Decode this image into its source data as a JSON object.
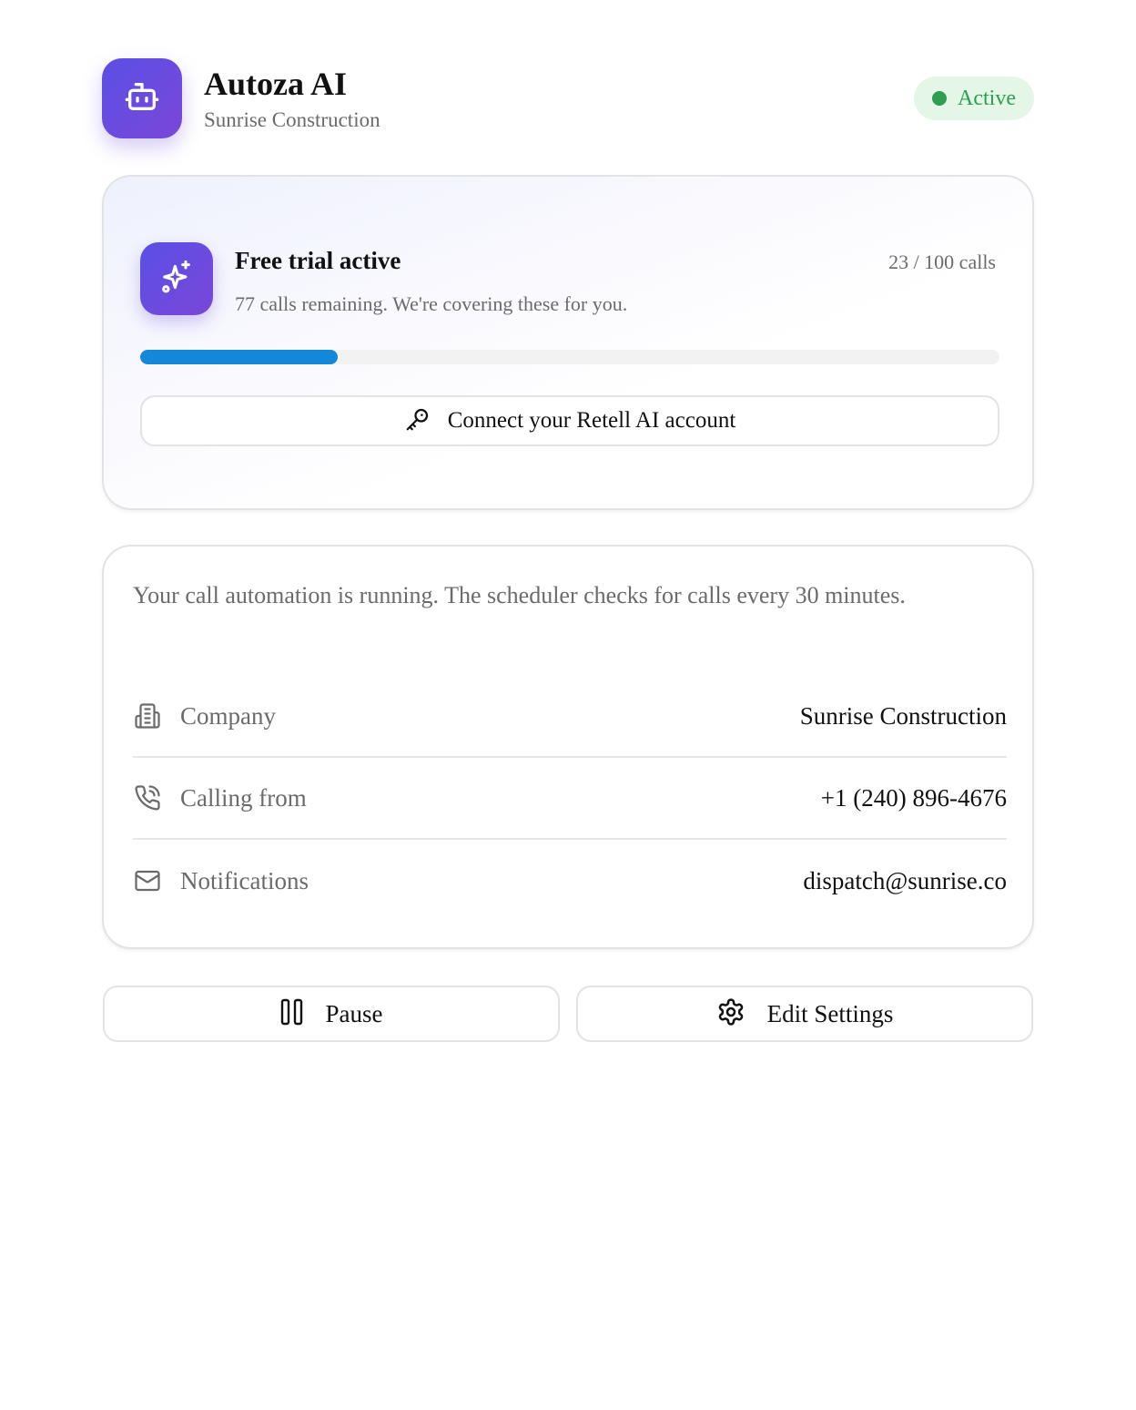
{
  "header": {
    "title": "Autoza AI",
    "subtitle": "Sunrise Construction",
    "logo_icon": "robot-icon",
    "status": {
      "label": "Active",
      "color": "#2e9e52"
    }
  },
  "trial": {
    "icon": "sparkles-icon",
    "title": "Free trial active",
    "count_label": "23 / 100 calls",
    "description": "77 calls remaining. We're covering these for you.",
    "progress_percent": 23,
    "progress_color": "#1487d9",
    "connect_button": {
      "icon": "key-icon",
      "label": "Connect your Retell AI account"
    }
  },
  "info": {
    "message": "Your call automation is running. The scheduler checks for calls every 30 minutes.",
    "rows": [
      {
        "icon": "building-icon",
        "label": "Company",
        "value": "Sunrise Construction"
      },
      {
        "icon": "phone-icon",
        "label": "Calling from",
        "value": "+1 (240) 896-4676"
      },
      {
        "icon": "mail-icon",
        "label": "Notifications",
        "value": "dispatch@sunrise.co"
      }
    ]
  },
  "actions": {
    "pause": {
      "icon": "pause-icon",
      "label": "Pause"
    },
    "edit": {
      "icon": "gear-icon",
      "label": "Edit Settings"
    }
  },
  "colors": {
    "accent_start": "#5b4fe6",
    "accent_end": "#7a47d8"
  }
}
